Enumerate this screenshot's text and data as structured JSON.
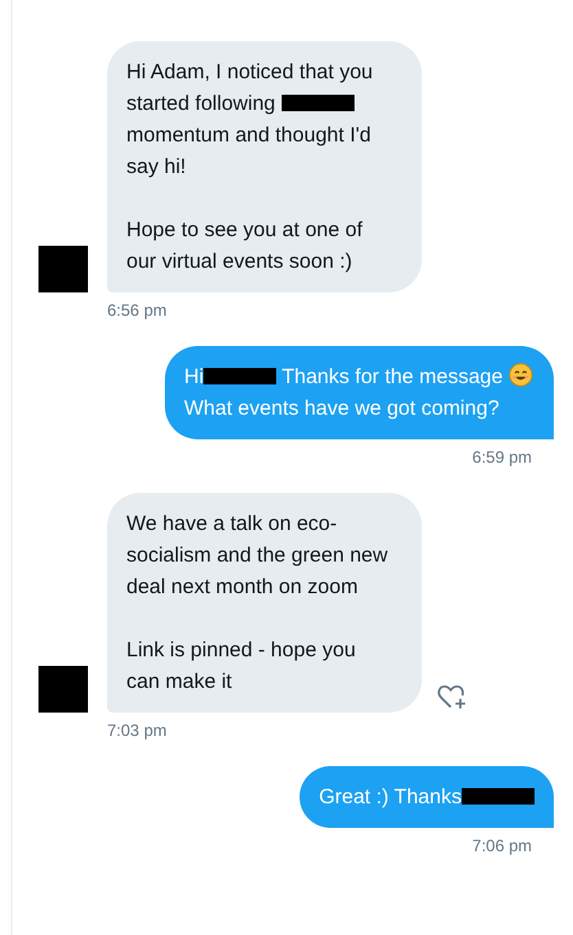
{
  "messages": [
    {
      "kind": "received",
      "paragraphs": [
        [
          {
            "kind": "text",
            "text": "Hi Adam, I noticed that you started following "
          },
          {
            "kind": "redaction"
          },
          {
            "kind": "text",
            "text": " momentum and thought I'd say hi!"
          }
        ],
        [
          {
            "kind": "text",
            "text": "Hope to see you at one of our virtual events soon :)"
          }
        ]
      ],
      "time": "6:56 pm",
      "reaction_button": false
    },
    {
      "kind": "sent",
      "paragraphs": [
        [
          {
            "kind": "text",
            "text": "Hi"
          },
          {
            "kind": "redaction"
          },
          {
            "kind": "text",
            "text": " Thanks for the message "
          },
          {
            "kind": "emoji"
          },
          {
            "kind": "text",
            "text": " What events have we got coming?"
          }
        ]
      ],
      "time": "6:59 pm",
      "reaction_button": false
    },
    {
      "kind": "received",
      "paragraphs": [
        [
          {
            "kind": "text",
            "text": "We have a talk on eco-socialism and the green new deal next month on zoom"
          }
        ],
        [
          {
            "kind": "text",
            "text": "Link is pinned - hope you can make it"
          }
        ]
      ],
      "time": "7:03 pm",
      "reaction_button": true
    },
    {
      "kind": "sent",
      "paragraphs": [
        [
          {
            "kind": "text",
            "text": "Great :) Thanks"
          },
          {
            "kind": "redaction"
          }
        ]
      ],
      "time": "7:06 pm",
      "reaction_button": false
    }
  ]
}
